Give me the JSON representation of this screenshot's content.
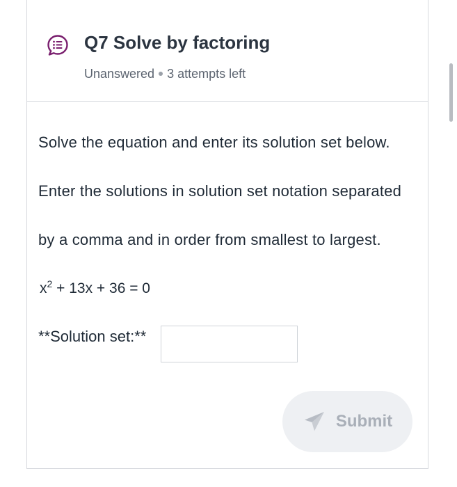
{
  "question": {
    "title": "Q7 Solve by factoring",
    "status": "Unanswered",
    "attempts": "3 attempts left",
    "icon": "question-list-icon"
  },
  "body": {
    "instruction_1": "Solve the equation and enter its solution set below.",
    "instruction_2": "Enter the solutions in solution set notation separated",
    "instruction_3": "by a comma and in order from smallest to largest.",
    "equation": {
      "base": "x",
      "exponent": "2",
      "rest": " + 13x + 36 = 0"
    },
    "solution_label": "**Solution set:**",
    "solution_value": ""
  },
  "actions": {
    "submit_label": "Submit",
    "submit_icon": "send-icon"
  },
  "colors": {
    "accent_purple": "#7a1f6e",
    "submit_bg": "#eef0f3",
    "submit_text": "#a9afb8"
  }
}
